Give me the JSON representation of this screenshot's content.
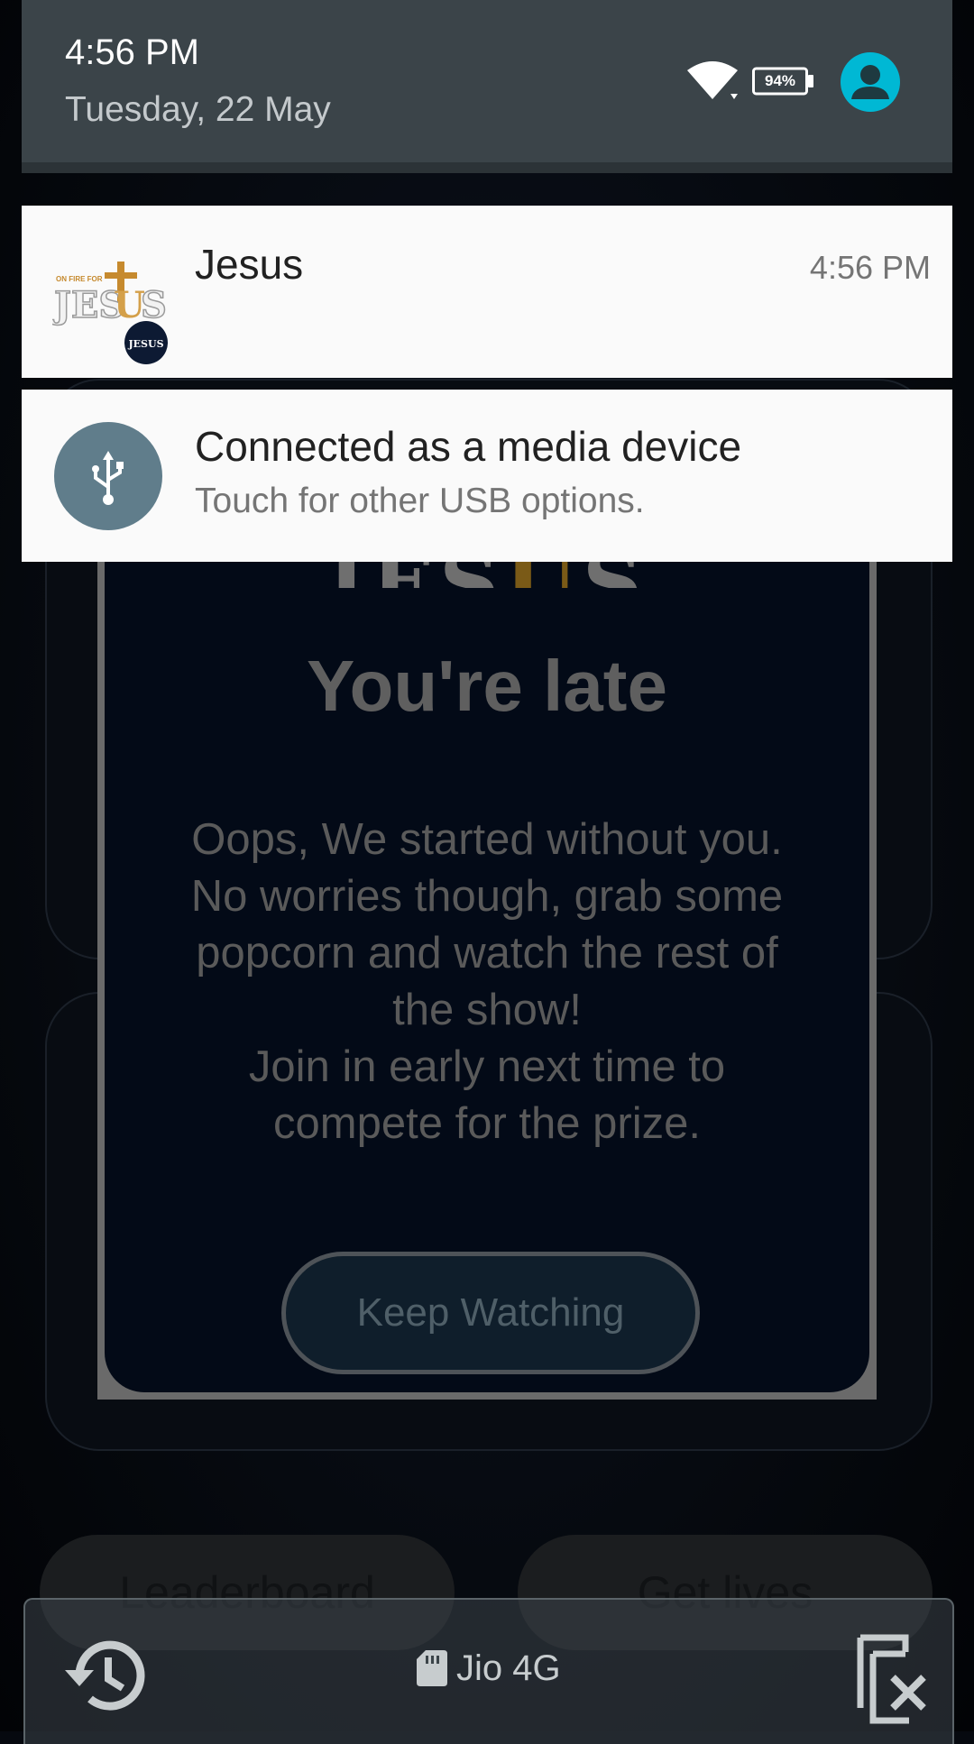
{
  "status": {
    "time": "4:56 PM",
    "date": "Tuesday, 22 May",
    "battery": "94%"
  },
  "notifications": [
    {
      "title": "Jesus",
      "time": "4:56 PM",
      "icon": "app-logo"
    },
    {
      "title": "Connected as a media device",
      "text": "Touch for other USB options.",
      "icon": "usb-icon"
    }
  ],
  "app": {
    "logo_fragment": "JESUS",
    "title": "You're late",
    "body_lines": [
      "Oops, We started without you.",
      "No worries though, grab some",
      "popcorn and watch the rest of",
      "the show!",
      "Join in early next time to",
      "compete for the prize."
    ],
    "keep_watching": "Keep Watching",
    "leaderboard": "Leaderboard",
    "get_lives": "Get lives"
  },
  "bottom_bar": {
    "carrier": "Jio 4G"
  },
  "colors": {
    "header_bg": "#3b4449",
    "notification_bg": "#fafafa",
    "avatar_accent": "#00b8d4",
    "usb_circle": "#607d8b"
  }
}
